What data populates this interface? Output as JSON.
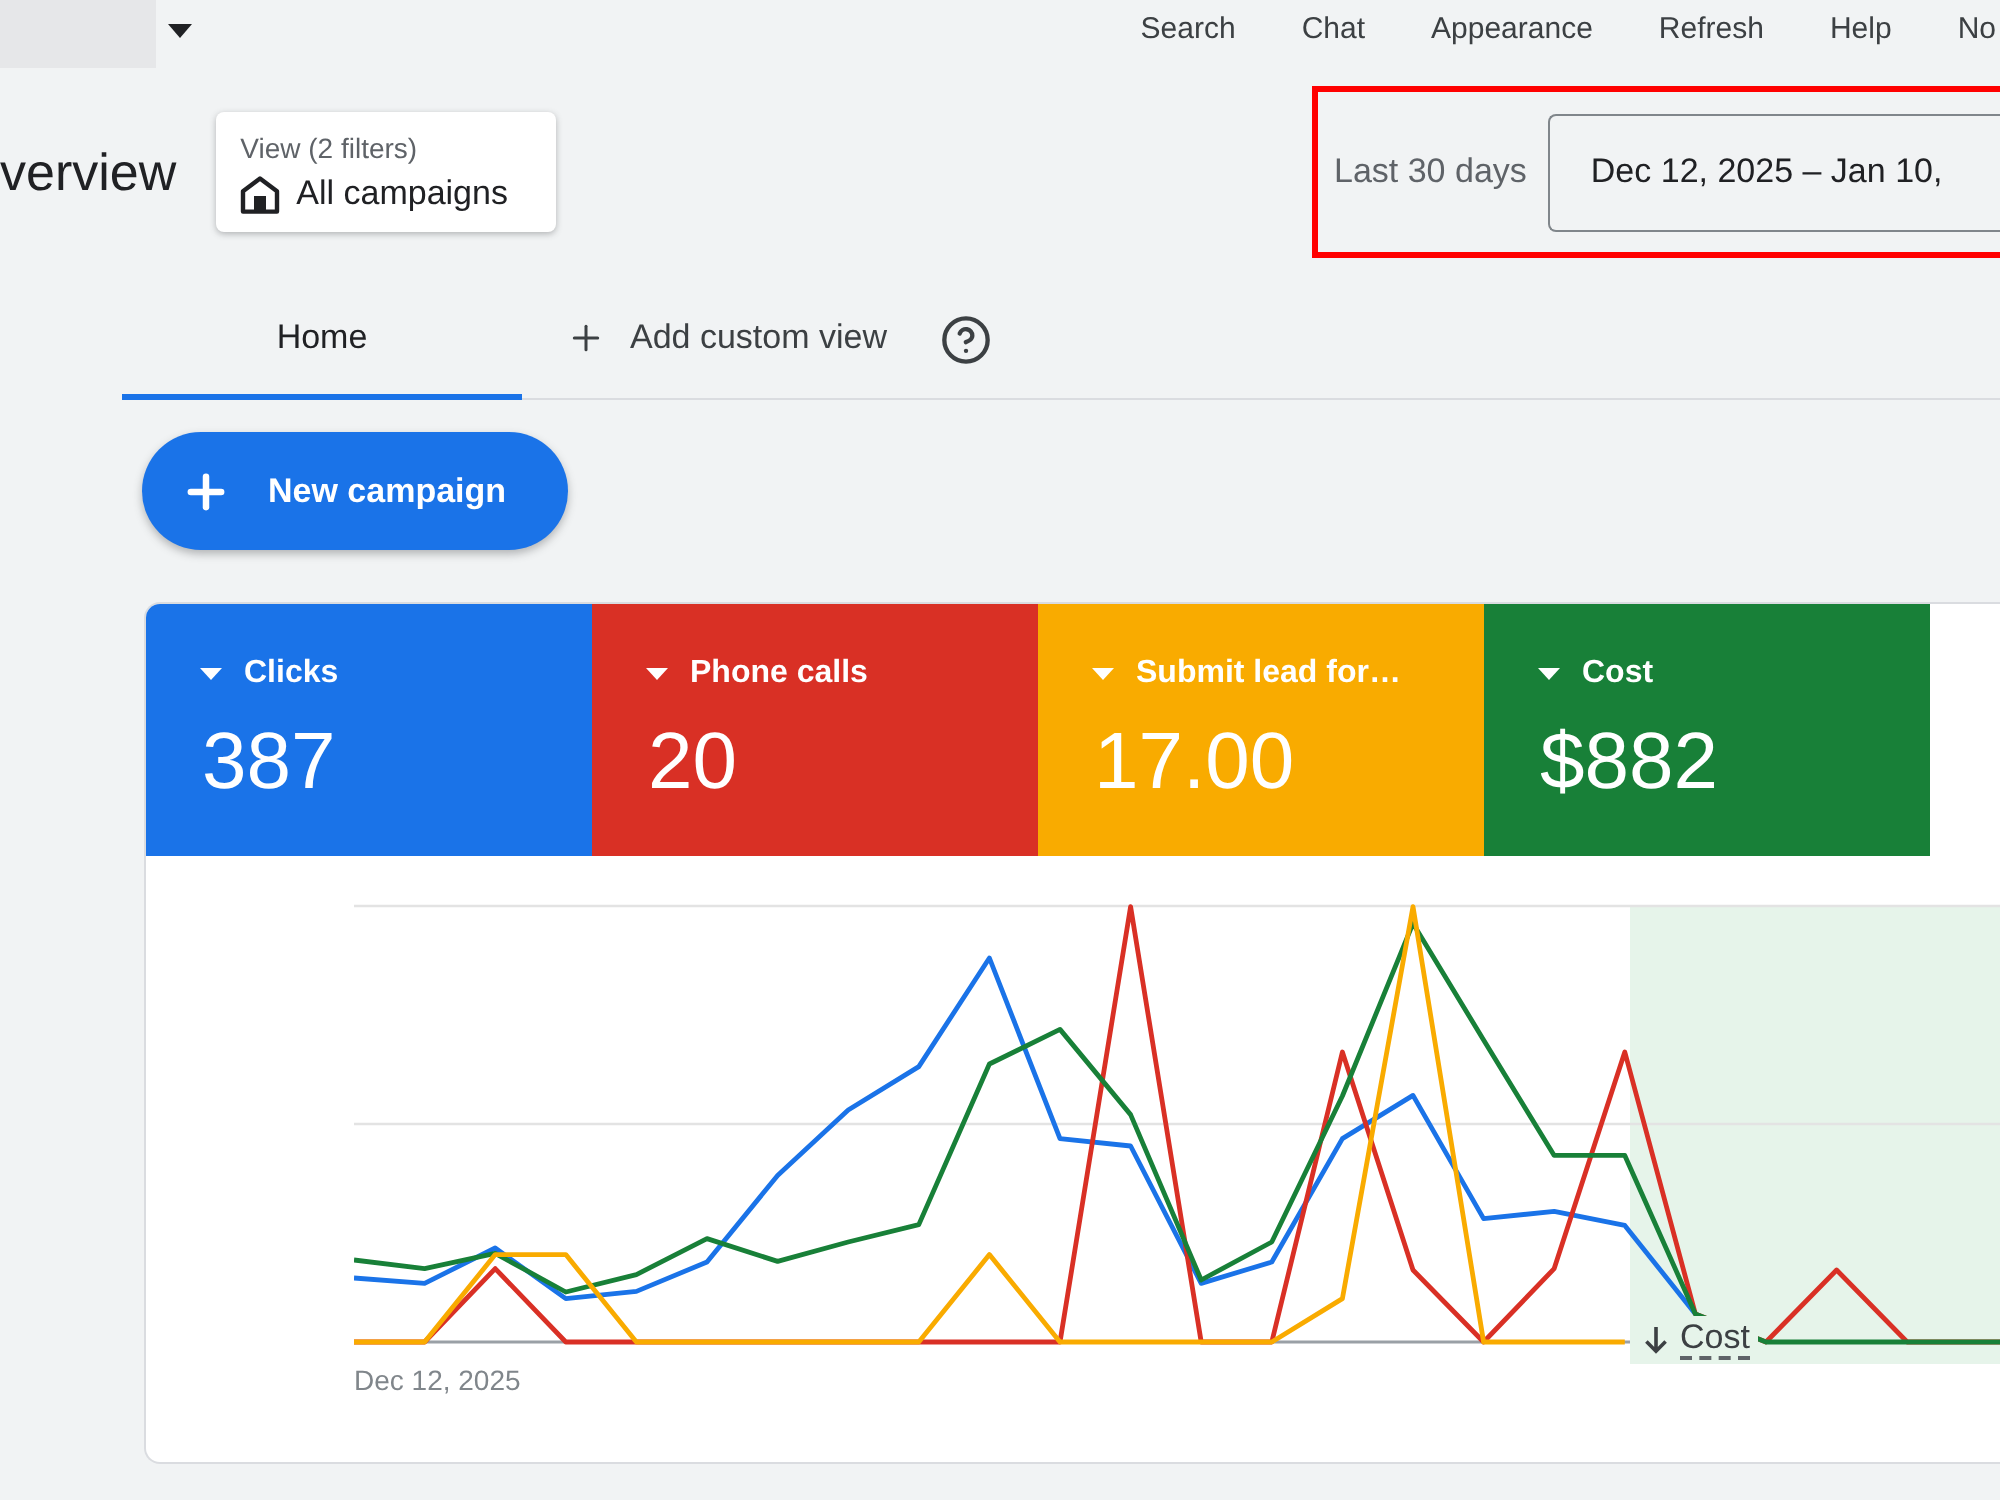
{
  "top_bar": {
    "nav_items": [
      "Search",
      "Chat",
      "Appearance",
      "Refresh",
      "Help",
      "No"
    ]
  },
  "header": {
    "title": "verview",
    "view_selector": {
      "label": "View (2 filters)",
      "value": "All campaigns"
    },
    "date_range": {
      "preset": "Last 30 days",
      "value": "Dec 12, 2025 – Jan 10,",
      "highlighted": true
    }
  },
  "tabs": [
    {
      "label": "Home",
      "kind": "tab",
      "selected": true
    },
    {
      "label": "Add custom view",
      "kind": "add",
      "selected": false
    }
  ],
  "new_campaign_button": {
    "label": "New campaign"
  },
  "metrics": [
    {
      "label": "Clicks",
      "value": "387",
      "color": "#1a73e8"
    },
    {
      "label": "Phone calls",
      "value": "20",
      "color": "#d93025"
    },
    {
      "label": "Submit lead for…",
      "value": "17.00",
      "color": "#f9ab00"
    },
    {
      "label": "Cost",
      "value": "$882",
      "color": "#188038"
    }
  ],
  "chart": {
    "date_label": "Dec 12, 2025",
    "marker_label": "Cost"
  }
}
